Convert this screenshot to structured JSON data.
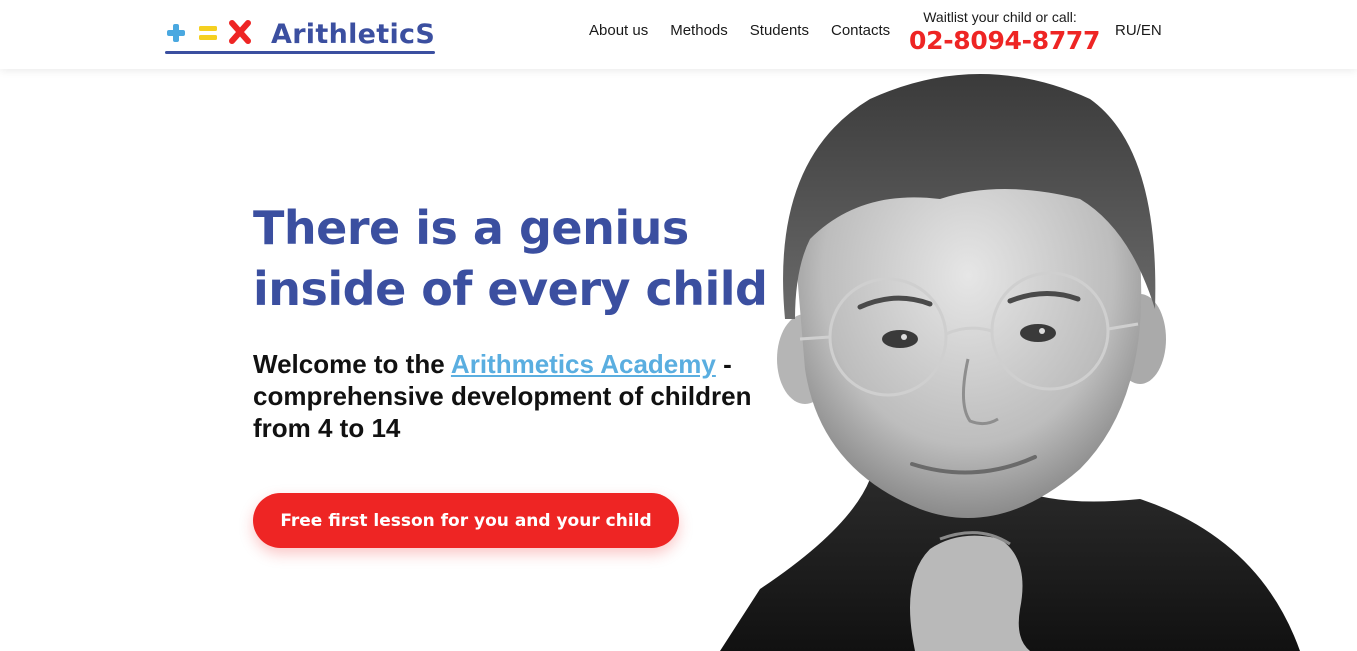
{
  "brand": {
    "name": "ArithleticS",
    "colors": {
      "plus": "#4aa8e0",
      "equals": "#f5d020",
      "times": "#ee2524",
      "text": "#3b4fa0"
    }
  },
  "nav": {
    "items": [
      {
        "label": "About us"
      },
      {
        "label": "Methods"
      },
      {
        "label": "Students"
      },
      {
        "label": "Contacts"
      }
    ]
  },
  "contact": {
    "waitlist_label": "Waitlist your child or call:",
    "phone": "02-8094-8777"
  },
  "language": {
    "label": "RU/EN"
  },
  "hero": {
    "title_line1": "There is a genius",
    "title_line2": "inside of every child",
    "subtitle_prefix": "Welcome to the ",
    "subtitle_link": "Arithmetics Academy",
    "subtitle_suffix": " - comprehensive development of children from 4 to 14",
    "cta_label": "Free first lesson for you and your child",
    "image": "black-and-white portrait of smiling boy with round glasses"
  },
  "colors": {
    "primary": "#3b4fa0",
    "accent": "#ee2524",
    "link": "#5aaee0"
  }
}
